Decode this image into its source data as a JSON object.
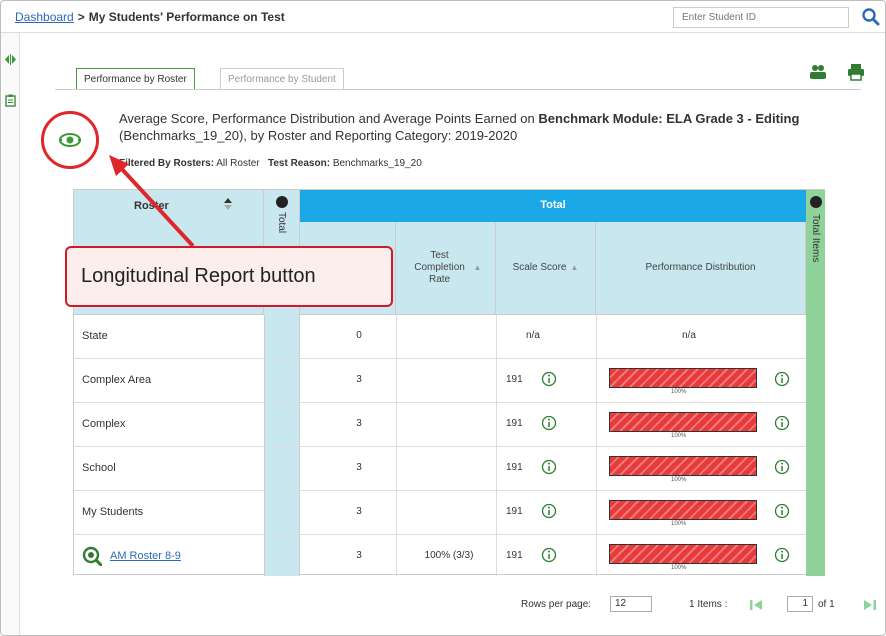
{
  "header": {
    "breadcrumb_link": "Dashboard",
    "breadcrumb_sep": ">",
    "title": "My Students' Performance on Test",
    "student_id_placeholder": "Enter Student ID"
  },
  "tabs": [
    {
      "label": "Performance by Roster",
      "active": true
    },
    {
      "label": "Performance by Student",
      "active": false
    }
  ],
  "report": {
    "heading_prefix": "Average Score, Performance Distribution and Average Points Earned on",
    "heading_bold": "Benchmark Module: ELA Grade 3 - Editing",
    "heading_line2": "(Benchmarks_19_20), by Roster and Reporting Category: 2019-2020",
    "filter_label_1": "Filtered By Rosters:",
    "filter_value_1": "All Roster",
    "filter_label_2": "Test Reason:",
    "filter_value_2": "Benchmarks_19_20"
  },
  "table": {
    "col_roster": "Roster",
    "col_total_group": "Total",
    "col_collapsed": "Total",
    "col_rate": "Test Completion Rate",
    "col_score": "Scale Score",
    "col_dist": "Performance Distribution",
    "col_side": "Total Items",
    "rows": [
      {
        "name": "State",
        "count": "0",
        "rate": "",
        "score": "n/a",
        "dist": "n/a",
        "link": false
      },
      {
        "name": "Complex Area",
        "count": "3",
        "rate": "",
        "score": "191",
        "dist_label": "100%",
        "link": false
      },
      {
        "name": "Complex",
        "count": "3",
        "rate": "",
        "score": "191",
        "dist_label": "100%",
        "link": false
      },
      {
        "name": "School",
        "count": "3",
        "rate": "",
        "score": "191",
        "dist_label": "100%",
        "link": false
      },
      {
        "name": "My Students",
        "count": "3",
        "rate": "",
        "score": "191",
        "dist_label": "100%",
        "link": false
      },
      {
        "name": "AM Roster 8-9",
        "count": "3",
        "rate": "100% (3/3)",
        "score": "191",
        "dist_label": "100%",
        "link": true
      }
    ]
  },
  "pager": {
    "rows_per_page_label": "Rows per page:",
    "rows_per_page": "12",
    "items_label": "1 Items :",
    "page": "1",
    "of_label": "of 1"
  },
  "callout": {
    "text": "Longitudinal Report button"
  },
  "colors": {
    "accent_blue": "#1ba8e6",
    "header_cell": "#c9e7ef",
    "side_green": "#8fd39b",
    "annotation_red": "#e0262b",
    "bar_red": "#e83a3a"
  }
}
